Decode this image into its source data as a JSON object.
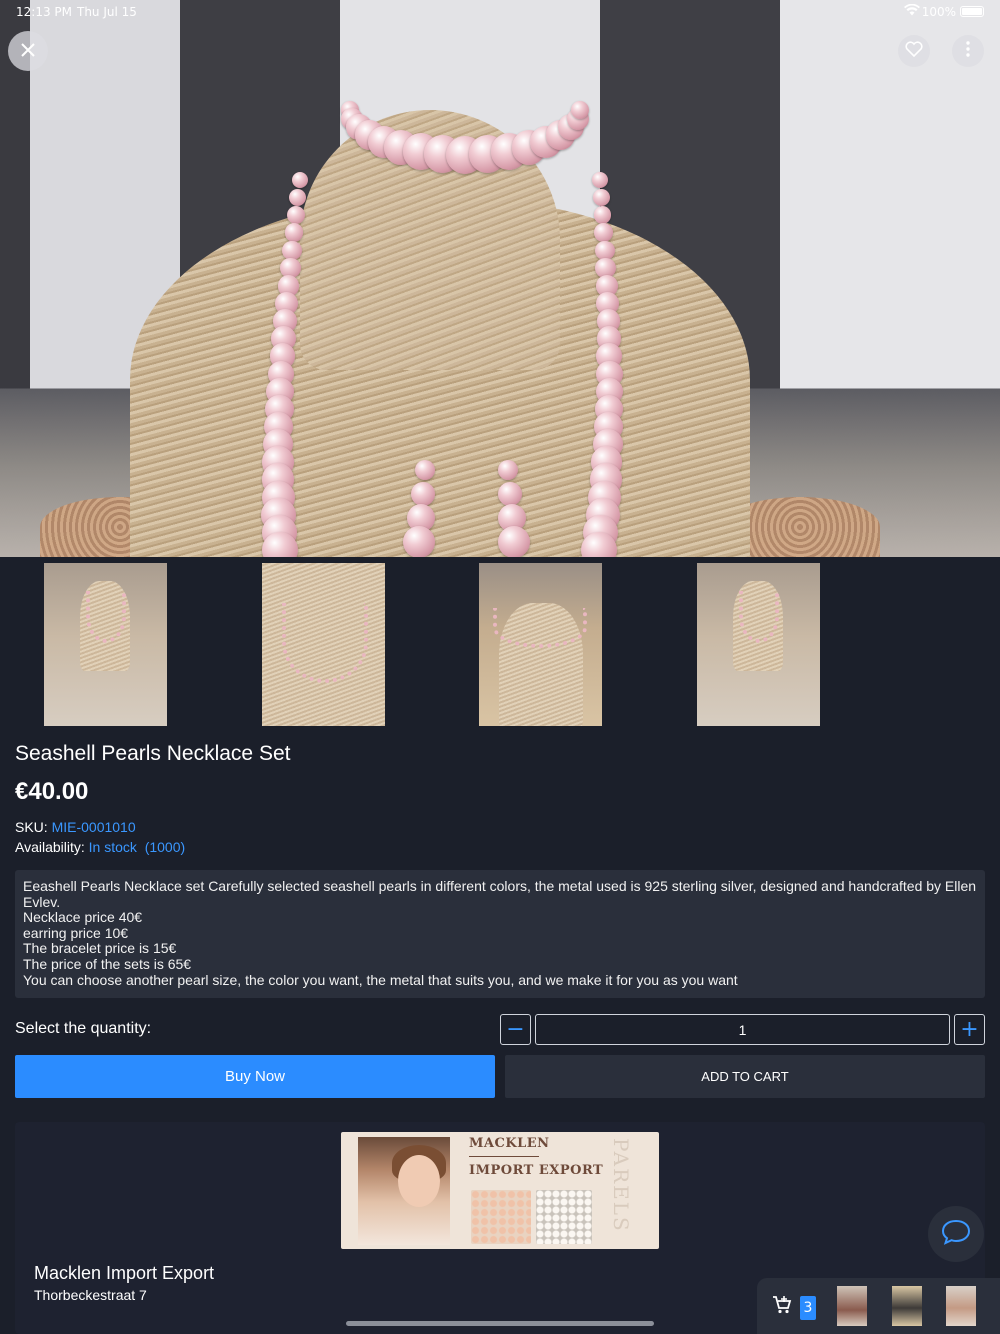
{
  "status_bar": {
    "time": "12:13 PM",
    "date": "Thu Jul 15",
    "battery_text": "100%"
  },
  "product": {
    "title": "Seashell Pearls Necklace Set",
    "price": "€40.00",
    "sku_label": "SKU:",
    "sku_value": "MIE-0001010",
    "availability_label": "Availability:",
    "availability_value": "In stock  (1000)",
    "description_lines": [
      "Eeashell Pearls Necklace set Carefully selected seashell pearls in different colors, the metal used is 925 sterling silver, designed and handcrafted by Ellen Evlev.",
      "Necklace price 40€",
      "earring price 10€",
      "The bracelet price is 15€",
      "The price of the sets is 65€",
      "You can choose another pearl size, the color you want, the metal that suits you, and we make it for you as you want"
    ]
  },
  "quantity": {
    "label": "Select the quantity:",
    "value": "1",
    "minus": "−",
    "plus": "+"
  },
  "actions": {
    "buy_now": "Buy Now",
    "add_to_cart": "ADD TO CART"
  },
  "shop": {
    "banner_line1": "MACKLEN",
    "banner_line2": "IMPORT EXPORT",
    "banner_vertical": "PARELS",
    "name": "Macklen Import Export",
    "address": "Thorbeckestraat 7"
  },
  "cart_tray": {
    "count": "3"
  },
  "colors": {
    "background": "#1b1f2a",
    "accent": "#2b8cff",
    "panel": "#2a2f3b"
  },
  "icons": {
    "close": "close-icon",
    "favorite": "heart-icon",
    "more": "more-vertical-icon",
    "chat": "chat-bubble-icon",
    "cart": "cart-add-icon"
  }
}
